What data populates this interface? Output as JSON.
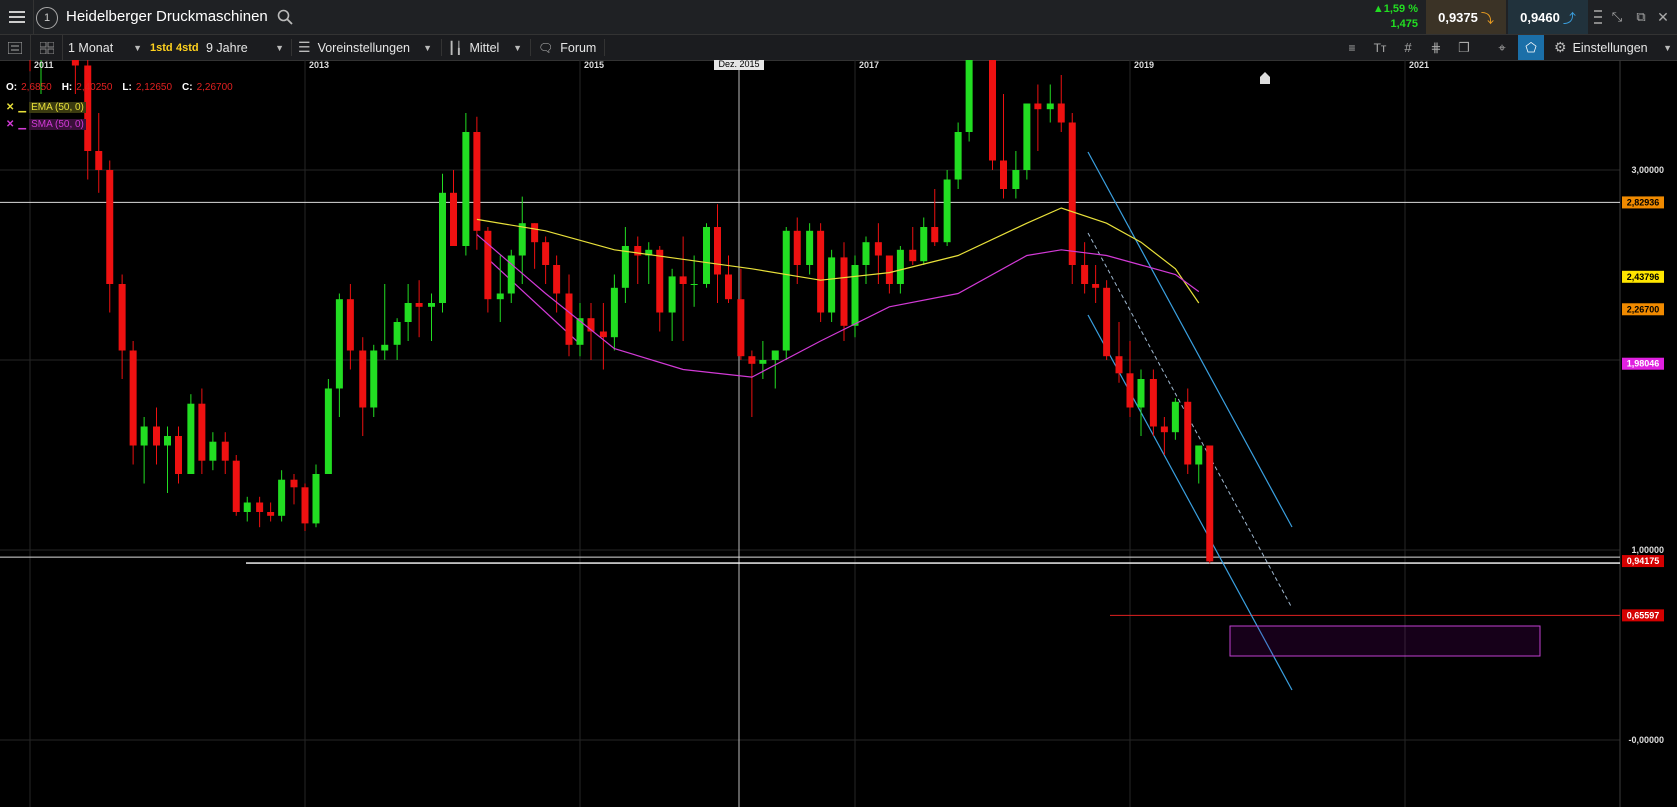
{
  "header": {
    "title": "Heidelberger Druckmaschinen",
    "change_pct": "▲1,59 %",
    "change_abs": "1,475",
    "bid": "0,9375",
    "ask": "0,9460"
  },
  "toolbar": {
    "interval": "1 Monat",
    "quick1": "1std",
    "quick2": "4std",
    "period": "9 Jahre",
    "presets": "Voreinstellungen",
    "average": "Mittel",
    "forum": "Forum",
    "settings": "Einstellungen"
  },
  "ohlc": {
    "o_label": "O:",
    "o": "2,6850",
    "h_label": "H:",
    "h": "2,40250",
    "l_label": "L:",
    "l": "2,12650",
    "c_label": "C:",
    "c": "2,26700"
  },
  "indicators": [
    {
      "label": "EMA (50, 0)",
      "color": "#e8e03a"
    },
    {
      "label": "SMA (50, 0)",
      "color": "#d23ad6"
    }
  ],
  "crosshair_label": "Dez. 2015",
  "chart_data": {
    "type": "candlestick",
    "x_labels": [
      "2011",
      "2013",
      "2015",
      "2017",
      "2019",
      "2021"
    ],
    "y_ticks": [
      "3,00000",
      "1,00000",
      "-0,00000"
    ],
    "price_tags": [
      {
        "value": 2.82936,
        "text": "2,82936",
        "bg": "#f08a00",
        "fg": "#000000"
      },
      {
        "value": 2.43796,
        "text": "2,43796",
        "bg": "#ffe600",
        "fg": "#000000"
      },
      {
        "value": 2.267,
        "text": "2,26700",
        "bg": "#f08a00",
        "fg": "#000000"
      },
      {
        "value": 1.98046,
        "text": "1,98046",
        "bg": "#e020e0",
        "fg": "#ffffff"
      },
      {
        "value": 0.94175,
        "text": "0,94175",
        "bg": "#d40000",
        "fg": "#ffffff"
      },
      {
        "value": 0.65597,
        "text": "0,65597",
        "bg": "#d40000",
        "fg": "#ffffff"
      }
    ],
    "colors": {
      "up": "#22dd22",
      "down": "#ee1111",
      "ema": "#e8e03a",
      "sma": "#d23ad6",
      "channel": "#3aa0e0"
    },
    "candles": [
      [
        2011.0,
        4.1,
        4.1,
        3.52,
        3.6
      ],
      [
        2011.08,
        3.6,
        3.82,
        3.4,
        3.7
      ],
      [
        2011.17,
        3.7,
        4.1,
        3.6,
        3.9
      ],
      [
        2011.25,
        3.9,
        4.15,
        3.7,
        3.75
      ],
      [
        2011.33,
        3.75,
        3.85,
        3.4,
        3.55
      ],
      [
        2011.42,
        3.55,
        3.7,
        2.95,
        3.1
      ],
      [
        2011.5,
        3.1,
        3.3,
        2.88,
        3.0
      ],
      [
        2011.58,
        3.0,
        3.05,
        2.25,
        2.4
      ],
      [
        2011.67,
        2.4,
        2.45,
        1.9,
        2.05
      ],
      [
        2011.75,
        2.05,
        2.1,
        1.45,
        1.55
      ],
      [
        2011.83,
        1.55,
        1.7,
        1.35,
        1.65
      ],
      [
        2011.92,
        1.65,
        1.75,
        1.45,
        1.55
      ],
      [
        2012.0,
        1.55,
        1.65,
        1.3,
        1.6
      ],
      [
        2012.08,
        1.6,
        1.65,
        1.35,
        1.4
      ],
      [
        2012.17,
        1.4,
        1.82,
        1.4,
        1.77
      ],
      [
        2012.25,
        1.77,
        1.85,
        1.4,
        1.47
      ],
      [
        2012.33,
        1.47,
        1.62,
        1.42,
        1.57
      ],
      [
        2012.42,
        1.57,
        1.62,
        1.4,
        1.47
      ],
      [
        2012.5,
        1.47,
        1.5,
        1.18,
        1.2
      ],
      [
        2012.58,
        1.2,
        1.28,
        1.15,
        1.25
      ],
      [
        2012.67,
        1.25,
        1.28,
        1.12,
        1.2
      ],
      [
        2012.75,
        1.2,
        1.25,
        1.15,
        1.18
      ],
      [
        2012.83,
        1.18,
        1.42,
        1.15,
        1.37
      ],
      [
        2012.92,
        1.37,
        1.4,
        1.24,
        1.33
      ],
      [
        2013.0,
        1.33,
        1.35,
        1.1,
        1.14
      ],
      [
        2013.08,
        1.14,
        1.45,
        1.12,
        1.4
      ],
      [
        2013.17,
        1.4,
        1.9,
        1.4,
        1.85
      ],
      [
        2013.25,
        1.85,
        2.35,
        1.7,
        2.32
      ],
      [
        2013.33,
        2.32,
        2.4,
        1.95,
        2.05
      ],
      [
        2013.42,
        2.05,
        2.12,
        1.6,
        1.75
      ],
      [
        2013.5,
        1.75,
        2.08,
        1.7,
        2.05
      ],
      [
        2013.58,
        2.05,
        2.4,
        2.0,
        2.08
      ],
      [
        2013.67,
        2.08,
        2.22,
        2.0,
        2.2
      ],
      [
        2013.75,
        2.2,
        2.4,
        2.1,
        2.3
      ],
      [
        2013.83,
        2.3,
        2.42,
        2.12,
        2.28
      ],
      [
        2013.92,
        2.28,
        2.35,
        2.1,
        2.3
      ],
      [
        2014.0,
        2.3,
        2.98,
        2.25,
        2.88
      ],
      [
        2014.08,
        2.88,
        3.0,
        2.6,
        2.6
      ],
      [
        2014.17,
        2.6,
        3.3,
        2.55,
        3.2
      ],
      [
        2014.25,
        3.2,
        3.28,
        2.58,
        2.68
      ],
      [
        2014.33,
        2.68,
        2.7,
        2.25,
        2.32
      ],
      [
        2014.42,
        2.32,
        2.55,
        2.2,
        2.35
      ],
      [
        2014.5,
        2.35,
        2.58,
        2.3,
        2.55
      ],
      [
        2014.58,
        2.55,
        2.86,
        2.4,
        2.72
      ],
      [
        2014.67,
        2.72,
        2.72,
        2.48,
        2.62
      ],
      [
        2014.75,
        2.62,
        2.65,
        2.4,
        2.5
      ],
      [
        2014.83,
        2.5,
        2.55,
        2.25,
        2.35
      ],
      [
        2014.92,
        2.35,
        2.45,
        2.02,
        2.08
      ],
      [
        2015.0,
        2.08,
        2.3,
        2.02,
        2.22
      ],
      [
        2015.08,
        2.22,
        2.3,
        2.0,
        2.15
      ],
      [
        2015.17,
        2.15,
        2.3,
        1.95,
        2.12
      ],
      [
        2015.25,
        2.12,
        2.45,
        2.05,
        2.38
      ],
      [
        2015.33,
        2.38,
        2.7,
        2.3,
        2.6
      ],
      [
        2015.42,
        2.6,
        2.65,
        2.4,
        2.55
      ],
      [
        2015.5,
        2.55,
        2.62,
        2.4,
        2.58
      ],
      [
        2015.58,
        2.58,
        2.6,
        2.15,
        2.25
      ],
      [
        2015.67,
        2.25,
        2.48,
        2.1,
        2.44
      ],
      [
        2015.75,
        2.44,
        2.65,
        2.1,
        2.4
      ],
      [
        2015.83,
        2.4,
        2.55,
        2.28,
        2.4
      ],
      [
        2015.92,
        2.4,
        2.72,
        2.38,
        2.7
      ],
      [
        2016.0,
        2.7,
        2.82,
        2.3,
        2.45
      ],
      [
        2016.08,
        2.45,
        2.55,
        2.3,
        2.32
      ],
      [
        2016.17,
        2.32,
        2.48,
        2.0,
        2.02
      ],
      [
        2016.25,
        2.02,
        2.05,
        1.7,
        1.98
      ],
      [
        2016.33,
        1.98,
        2.1,
        1.9,
        2.0
      ],
      [
        2016.42,
        2.0,
        2.05,
        1.85,
        2.05
      ],
      [
        2016.5,
        2.05,
        2.7,
        2.0,
        2.68
      ],
      [
        2016.58,
        2.68,
        2.75,
        2.4,
        2.5
      ],
      [
        2016.67,
        2.5,
        2.72,
        2.45,
        2.68
      ],
      [
        2016.75,
        2.68,
        2.72,
        2.2,
        2.25
      ],
      [
        2016.83,
        2.25,
        2.58,
        2.2,
        2.54
      ],
      [
        2016.92,
        2.54,
        2.62,
        2.1,
        2.18
      ],
      [
        2017.0,
        2.18,
        2.55,
        2.12,
        2.5
      ],
      [
        2017.08,
        2.5,
        2.65,
        2.4,
        2.62
      ],
      [
        2017.17,
        2.62,
        2.72,
        2.4,
        2.55
      ],
      [
        2017.25,
        2.55,
        2.55,
        2.35,
        2.4
      ],
      [
        2017.33,
        2.4,
        2.6,
        2.35,
        2.58
      ],
      [
        2017.42,
        2.58,
        2.7,
        2.5,
        2.52
      ],
      [
        2017.5,
        2.52,
        2.75,
        2.5,
        2.7
      ],
      [
        2017.58,
        2.7,
        2.9,
        2.6,
        2.62
      ],
      [
        2017.67,
        2.62,
        3.0,
        2.6,
        2.95
      ],
      [
        2017.75,
        2.95,
        3.25,
        2.9,
        3.2
      ],
      [
        2017.83,
        3.2,
        3.75,
        3.15,
        3.7
      ],
      [
        2017.92,
        3.7,
        3.88,
        3.65,
        3.72
      ],
      [
        2018.0,
        3.72,
        3.75,
        3.0,
        3.05
      ],
      [
        2018.08,
        3.05,
        3.4,
        2.85,
        2.9
      ],
      [
        2018.17,
        2.9,
        3.1,
        2.85,
        3.0
      ],
      [
        2018.25,
        3.0,
        3.35,
        2.95,
        3.35
      ],
      [
        2018.33,
        3.35,
        3.45,
        3.1,
        3.32
      ],
      [
        2018.42,
        3.32,
        3.45,
        3.25,
        3.35
      ],
      [
        2018.5,
        3.35,
        3.5,
        3.2,
        3.25
      ],
      [
        2018.58,
        3.25,
        3.3,
        2.4,
        2.5
      ],
      [
        2018.67,
        2.5,
        2.62,
        2.35,
        2.4
      ],
      [
        2018.75,
        2.4,
        2.5,
        2.3,
        2.38
      ],
      [
        2018.83,
        2.38,
        2.42,
        2.0,
        2.02
      ],
      [
        2018.92,
        2.02,
        2.2,
        1.88,
        1.93
      ],
      [
        2019.0,
        1.93,
        2.1,
        1.7,
        1.75
      ],
      [
        2019.08,
        1.75,
        1.95,
        1.6,
        1.9
      ],
      [
        2019.17,
        1.9,
        1.95,
        1.6,
        1.65
      ],
      [
        2019.25,
        1.65,
        1.7,
        1.5,
        1.62
      ],
      [
        2019.33,
        1.62,
        1.8,
        1.58,
        1.78
      ],
      [
        2019.42,
        1.78,
        1.85,
        1.4,
        1.45
      ],
      [
        2019.5,
        1.45,
        1.55,
        1.35,
        1.55
      ],
      [
        2019.58,
        1.55,
        1.55,
        0.93,
        0.94
      ]
    ],
    "ema": [
      [
        2014.25,
        2.74
      ],
      [
        2014.75,
        2.68
      ],
      [
        2015.25,
        2.58
      ],
      [
        2015.75,
        2.53
      ],
      [
        2016.25,
        2.48
      ],
      [
        2016.75,
        2.42
      ],
      [
        2017.25,
        2.46
      ],
      [
        2017.75,
        2.55
      ],
      [
        2018.25,
        2.72
      ],
      [
        2018.5,
        2.8
      ],
      [
        2018.83,
        2.72
      ],
      [
        2019.08,
        2.62
      ],
      [
        2019.33,
        2.48
      ],
      [
        2019.5,
        2.3
      ]
    ],
    "sma": [
      [
        2014.25,
        2.66
      ],
      [
        2014.75,
        2.35
      ],
      [
        2015.25,
        2.06
      ],
      [
        2015.75,
        1.95
      ],
      [
        2016.25,
        1.91
      ],
      [
        2016.75,
        2.1
      ],
      [
        2017.25,
        2.28
      ],
      [
        2017.75,
        2.35
      ],
      [
        2018.25,
        2.55
      ],
      [
        2018.5,
        2.58
      ],
      [
        2018.83,
        2.55
      ],
      [
        2019.08,
        2.5
      ],
      [
        2019.33,
        2.45
      ],
      [
        2019.5,
        2.36
      ]
    ]
  }
}
